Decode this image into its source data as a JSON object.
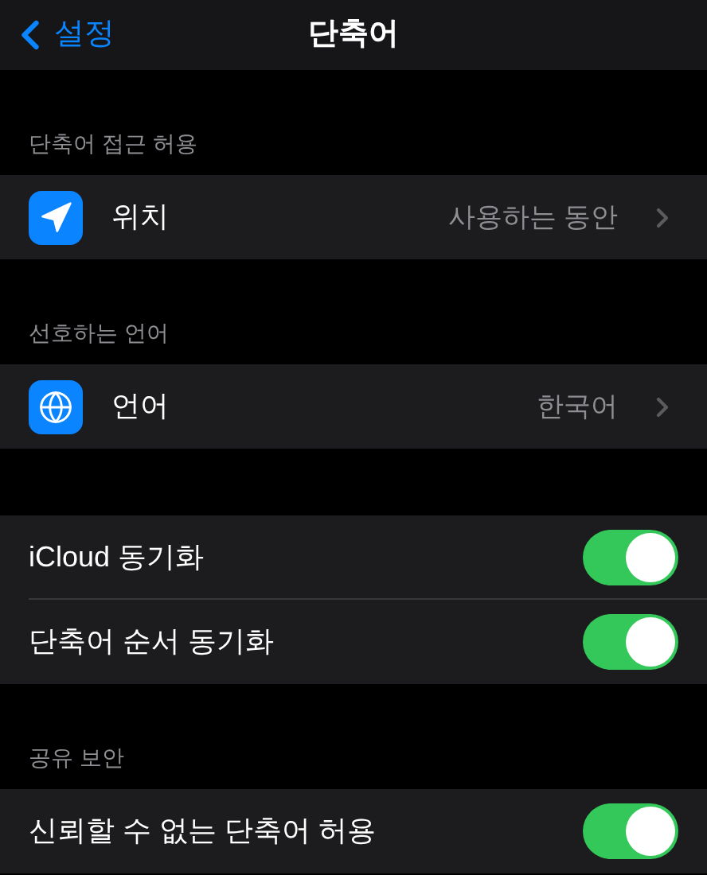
{
  "nav": {
    "back": "설정",
    "title": "단축어"
  },
  "sections": [
    {
      "header": "단축어 접근 허용",
      "rows": [
        {
          "kind": "link",
          "label": "위치",
          "value": "사용하는 동안"
        }
      ]
    },
    {
      "header": "선호하는 언어",
      "rows": [
        {
          "kind": "link",
          "label": "언어",
          "value": "한국어"
        }
      ]
    },
    {
      "rows": [
        {
          "kind": "toggle",
          "label": "iCloud 동기화",
          "on": true
        },
        {
          "kind": "toggle",
          "label": "단축어 순서 동기화",
          "on": true
        }
      ]
    },
    {
      "header": "공유 보안",
      "rows": [
        {
          "kind": "toggle",
          "label": "신뢰할 수 없는 단축어 허용",
          "on": true
        }
      ]
    }
  ]
}
